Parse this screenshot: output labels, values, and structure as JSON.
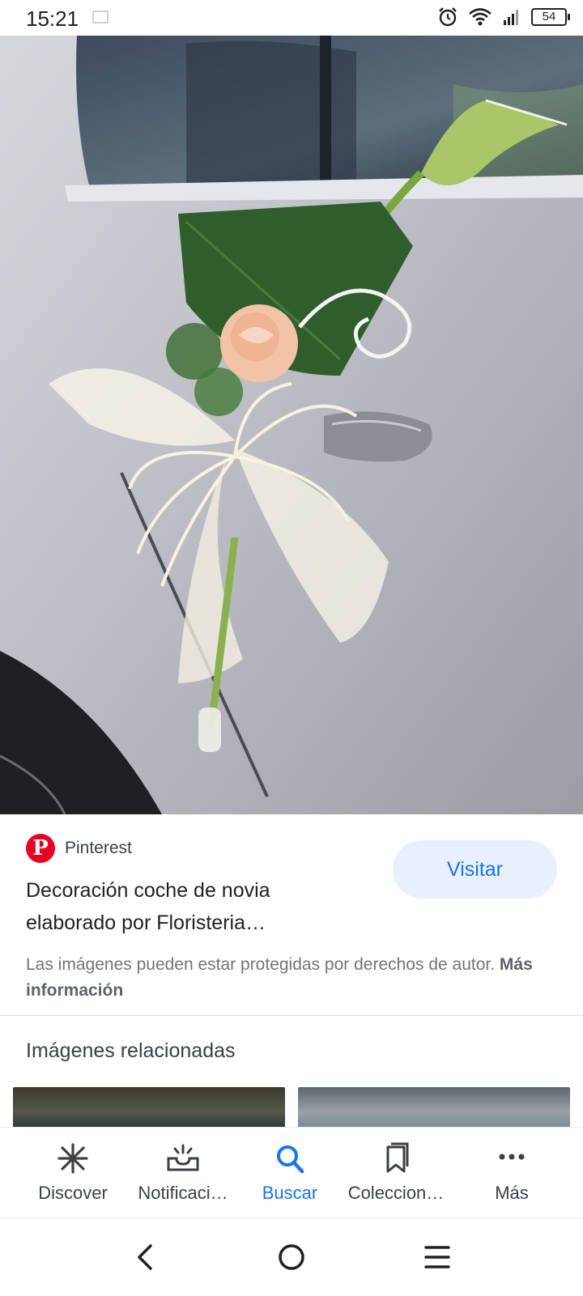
{
  "status_bar": {
    "time": "15:21",
    "battery": "54"
  },
  "result": {
    "source": "Pinterest",
    "title_line1": "Decoración coche de novia",
    "title_line2": "elaborado por Floristeria…",
    "visit_label": "Visitar",
    "copyright_text": "Las imágenes pueden estar protegidas por derechos de autor.",
    "copyright_link": "Más información"
  },
  "related": {
    "title": "Imágenes relacionadas"
  },
  "bottom_nav": {
    "items": [
      {
        "label": "Discover",
        "icon": "asterisk-icon",
        "active": false
      },
      {
        "label": "Notificaci…",
        "icon": "notification-tray-icon",
        "active": false
      },
      {
        "label": "Buscar",
        "icon": "search-icon",
        "active": true
      },
      {
        "label": "Coleccion…",
        "icon": "collections-icon",
        "active": false
      },
      {
        "label": "Más",
        "icon": "more-icon",
        "active": false
      }
    ]
  },
  "colors": {
    "accent": "#1a73e8",
    "pinterest": "#e60023",
    "visit_bg": "#e8f0fe"
  }
}
